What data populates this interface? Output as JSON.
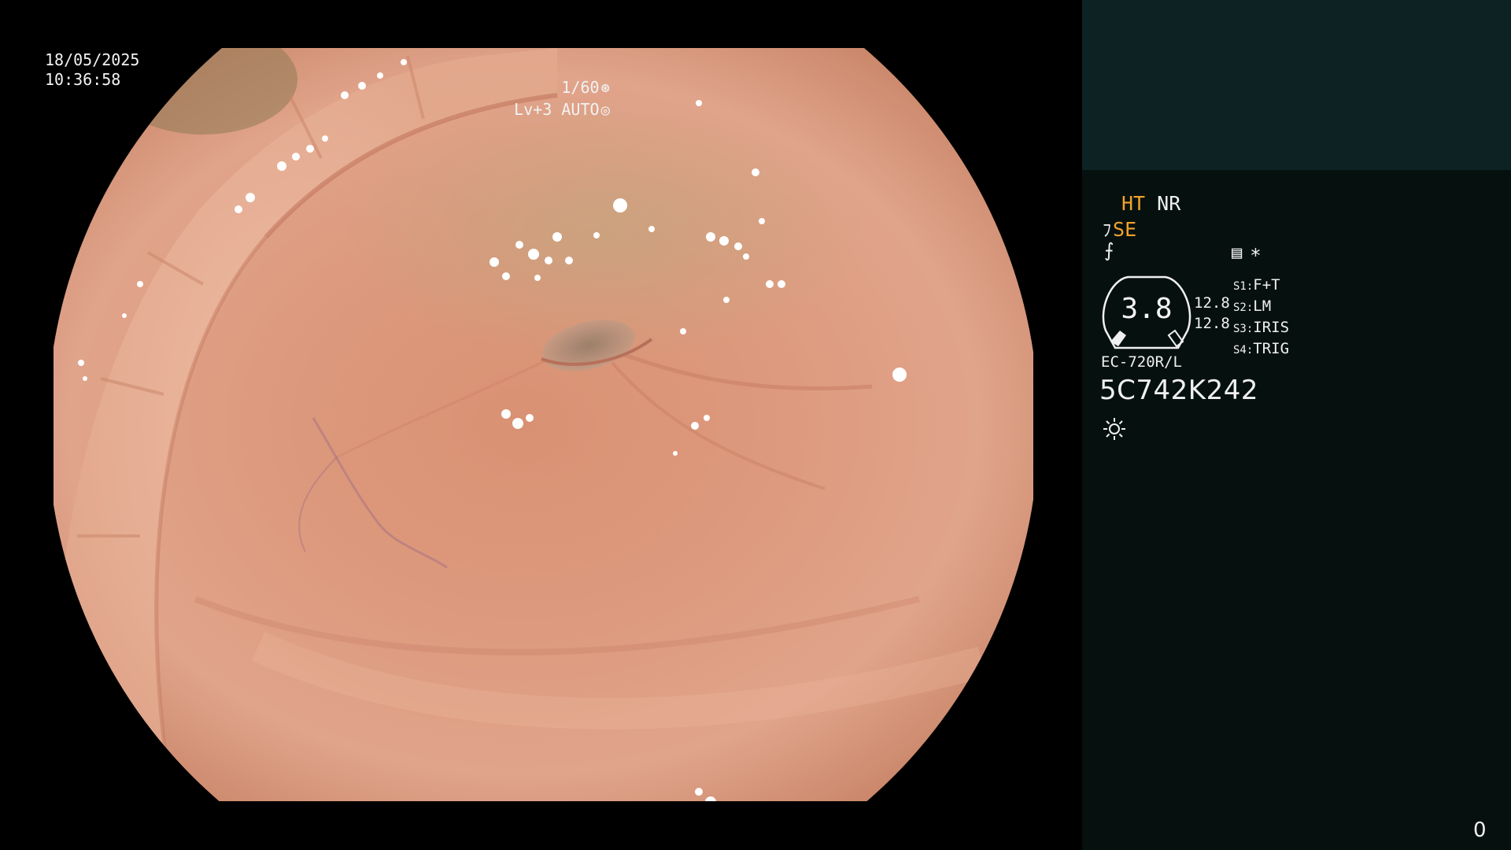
{
  "osd": {
    "date": "18/05/2025",
    "time": "10:36:58",
    "shutter": "1/60",
    "level": "Lv+3 AUTO"
  },
  "panel": {
    "ht": "HT",
    "nr": "NR",
    "se": "SE",
    "gauge_value": "3.8",
    "value_1": "12.8",
    "value_2": "12.8",
    "switches": [
      {
        "key": "S1:",
        "value": "F+T"
      },
      {
        "key": "S2:",
        "value": "LM"
      },
      {
        "key": "S3:",
        "value": "IRIS"
      },
      {
        "key": "S4:",
        "value": "TRIG"
      }
    ],
    "scope_model": "EC-720R/L",
    "scope_serial": "5C742K242",
    "counter": "0"
  },
  "icons": {
    "shutter": "aperture-icon",
    "auto": "auto-exposure-icon",
    "se_mode": "structure-enhancement-icon",
    "freeze": "freeze-icon",
    "menu": "menu-list-icon",
    "star": "asterisk-icon",
    "light": "light-source-icon"
  },
  "colors": {
    "panel_bg": "#06110f",
    "panel_top_bg": "#0c2223",
    "accent_orange": "#f2a22a",
    "text": "#f0f0f0"
  }
}
